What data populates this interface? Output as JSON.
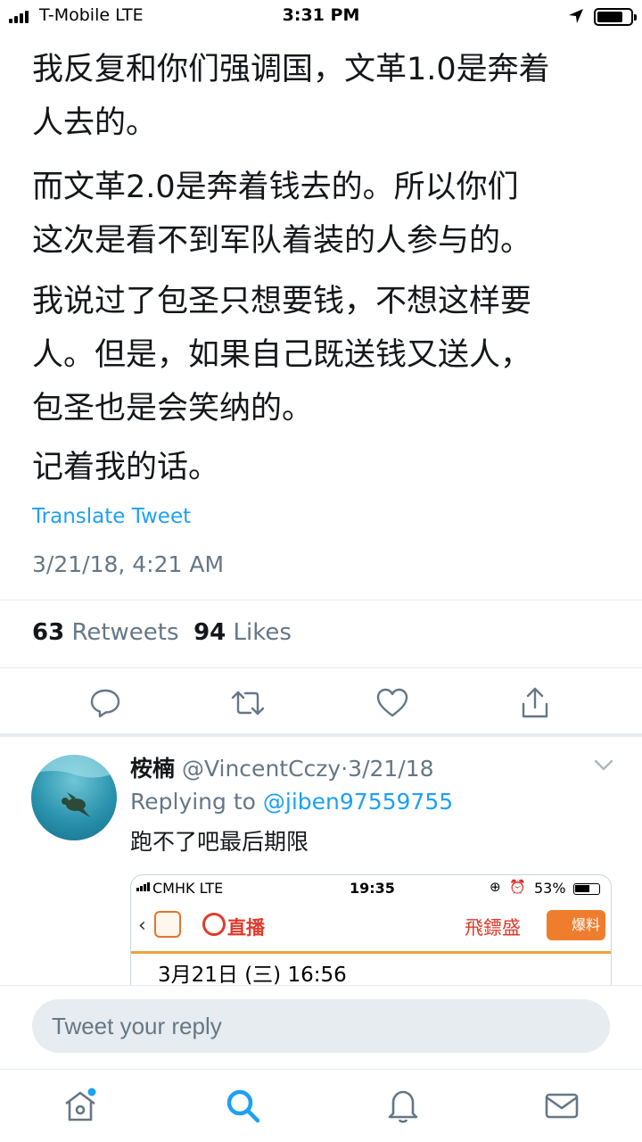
{
  "status_bar": {
    "carrier": "T-Mobile  LTE",
    "time": "3:31 PM"
  },
  "tweet": {
    "paragraphs": [
      [
        "我反复和你们强调国，文革1.0是奔着",
        "人去的。"
      ],
      [
        "而文革2.0是奔着钱去的。所以你们",
        "这次是看不到军队着装的人参与的。"
      ],
      [
        "我说过了包圣只想要钱，不想这样要",
        "人。但是，如果自己既送钱又送人，",
        "包圣也是会笑纳的。"
      ],
      [
        "记着我的话。"
      ]
    ],
    "translate_label": "Translate Tweet",
    "timestamp": "3/21/18, 4:21 AM",
    "retweets_count": "63",
    "retweets_label": "Retweets",
    "likes_count": "94",
    "likes_label": "Likes"
  },
  "actions": [
    "reply-icon",
    "retweet-icon",
    "like-icon",
    "share-icon"
  ],
  "reply": {
    "display_name": "桉楠",
    "handle": "@VincentCczy",
    "separator": "·",
    "date": "3/21/18",
    "replying_prefix": "Replying to",
    "replying_handle": "@jiben97559755",
    "text": "跑不了吧最后期限",
    "embed": {
      "carrier": "CMHK  LTE",
      "time": "19:35",
      "battery": "53%",
      "live_label": "直播",
      "channel_label": "飛鏢盛",
      "report_label": "爆料",
      "datetime": "3月21日 (三) 16:56"
    }
  },
  "reply_box": {
    "placeholder": "Tweet your reply"
  },
  "tabs": [
    "home-icon",
    "search-icon",
    "notifications-icon",
    "messages-icon"
  ],
  "colors": {
    "accent": "#1da1f2",
    "text": "#14171a",
    "secondary": "#657786",
    "divider": "#e6ecf0"
  }
}
